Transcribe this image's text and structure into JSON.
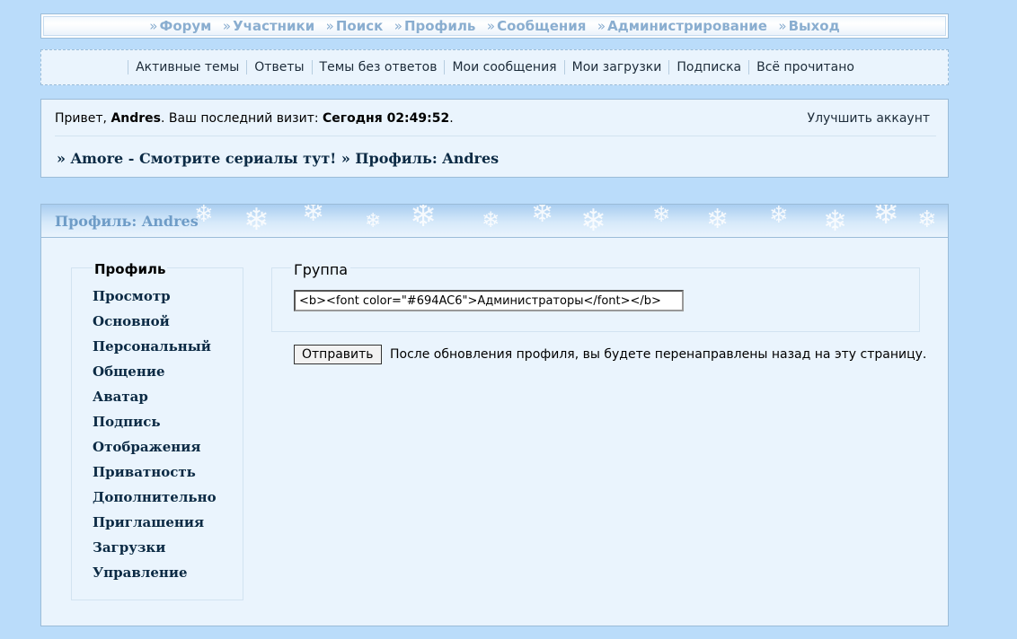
{
  "topnav": [
    {
      "label": "Форум"
    },
    {
      "label": "Участники"
    },
    {
      "label": "Поиск"
    },
    {
      "label": "Профиль"
    },
    {
      "label": "Сообщения"
    },
    {
      "label": "Администрирование"
    },
    {
      "label": "Выход"
    }
  ],
  "quicklinks": [
    "Активные темы",
    "Ответы",
    "Темы без ответов",
    "Мои сообщения",
    "Мои загрузки",
    "Подписка",
    "Всё прочитано"
  ],
  "welcome": {
    "greeting": "Привет, ",
    "username": "Andres",
    "visit_text": ".  Ваш последний визит: ",
    "visit_time": "Сегодня 02:49:52",
    "dot": ".",
    "upgrade": "Улучшить аккаунт"
  },
  "breadcrumbs": {
    "sep": "»",
    "forum": "Amore - Смотрите сериалы тут!",
    "page": "Профиль: Andres"
  },
  "panel": {
    "title": "Профиль: Andres"
  },
  "sidemenu": {
    "title": "Профиль",
    "items": [
      "Просмотр",
      "Основной",
      "Персональный",
      "Общение",
      "Аватар",
      "Подпись",
      "Отображения",
      "Приватность",
      "Дополнительно",
      "Приглашения",
      "Загрузки",
      "Управление"
    ]
  },
  "group": {
    "legend": "Группа",
    "value": "<b><font color=\"#694AC6\">Администраторы</font></b>"
  },
  "submit": {
    "label": "Отправить",
    "note": "После обновления профиля, вы будете перенаправлены назад на эту страницу."
  },
  "colors": {
    "background": "#badcfa",
    "nav_link": "#8aaed0",
    "panel_title": "#6e9cc7",
    "link_dark": "#0b2a44"
  }
}
